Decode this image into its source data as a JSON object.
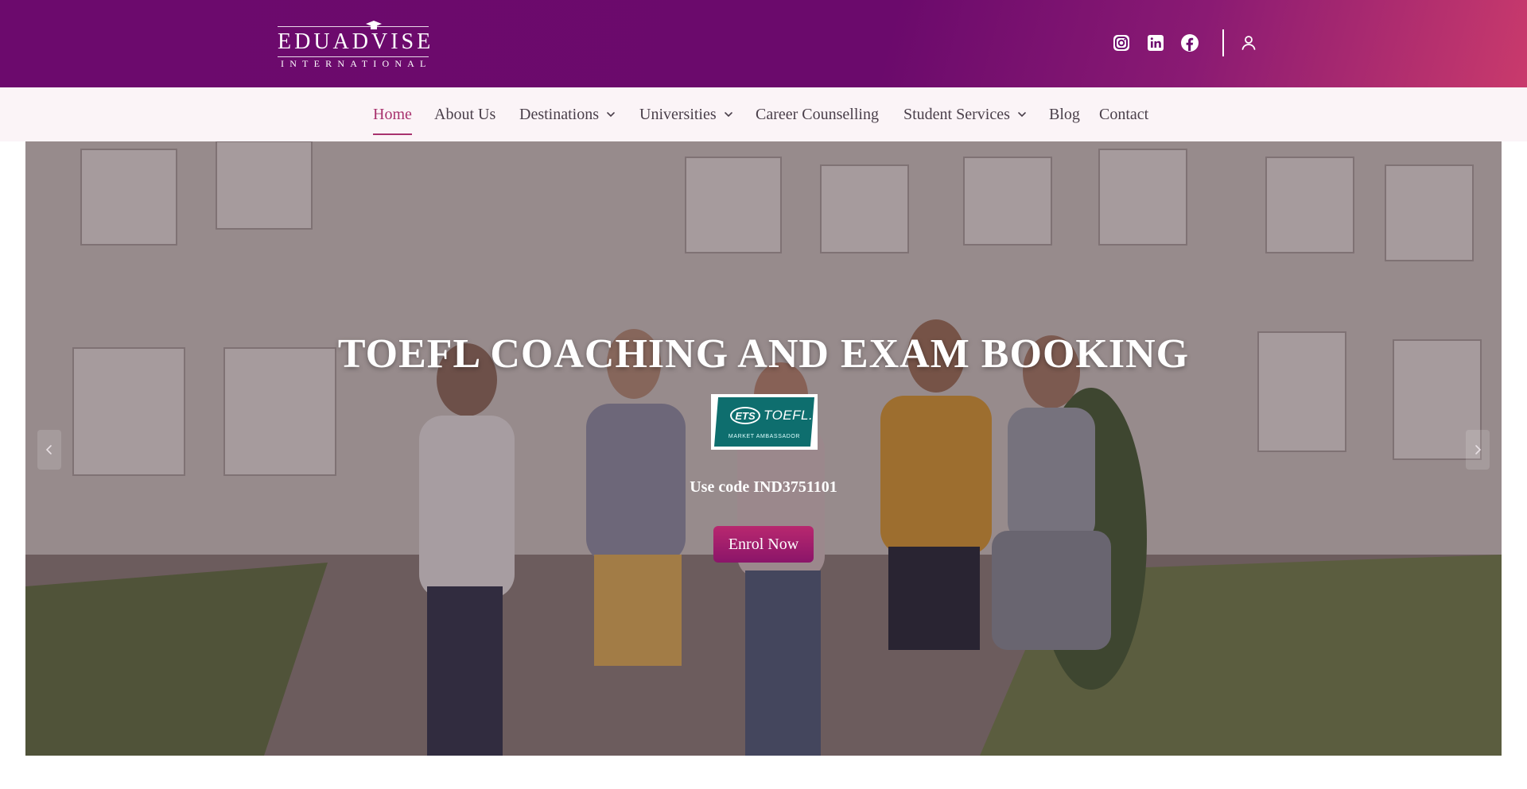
{
  "header": {
    "logo_text": "EDUADVISE",
    "logo_subtext": "INTERNATIONAL",
    "social": [
      {
        "icon": "instagram-icon"
      },
      {
        "icon": "linkedin-icon"
      },
      {
        "icon": "facebook-icon"
      }
    ],
    "account_icon": "user-icon"
  },
  "nav": {
    "items": [
      {
        "label": "Home",
        "active": true
      },
      {
        "label": "About Us"
      },
      {
        "label": "Destinations",
        "dropdown": true
      },
      {
        "label": "Universities",
        "dropdown": true
      },
      {
        "label": "Career Counselling"
      },
      {
        "label": "Student Services",
        "dropdown": true
      },
      {
        "label": "Blog"
      },
      {
        "label": "Contact"
      }
    ]
  },
  "hero": {
    "title": "TOEFL COACHING AND EXAM BOOKING",
    "badge": {
      "ets": "ETS",
      "word": "TOEFL.",
      "caption": "MARKET AMBASSADOR"
    },
    "promo": "Use code IND3751101",
    "cta_label": "Enrol Now"
  },
  "colors": {
    "brand_purple": "#6c0a6d",
    "brand_pink": "#c93a6c",
    "nav_active": "#a8326e",
    "cta": "#b8286f"
  }
}
